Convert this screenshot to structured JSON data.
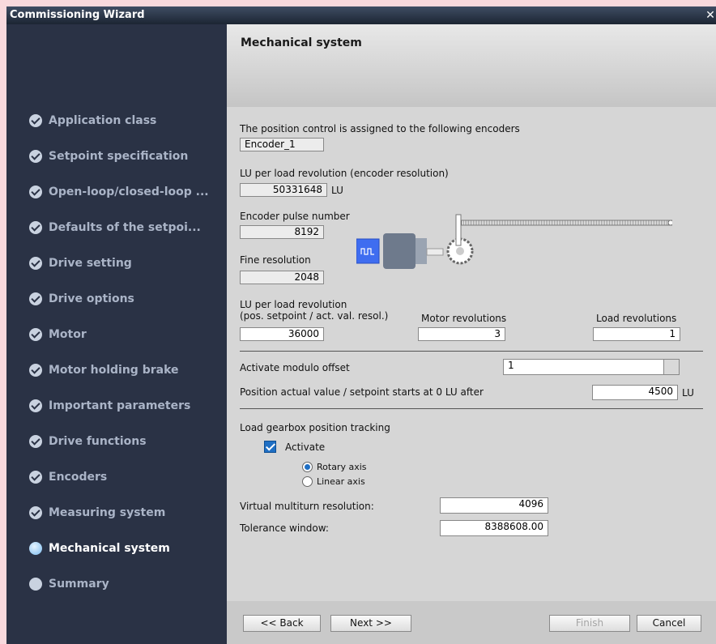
{
  "window": {
    "title": "Commissioning Wizard",
    "close_glyph": "✕"
  },
  "sidebar": {
    "items": [
      {
        "label": "Application class",
        "state": "done"
      },
      {
        "label": "Setpoint specification",
        "state": "done"
      },
      {
        "label": "Open-loop/closed-loop ...",
        "state": "done"
      },
      {
        "label": "Defaults of the setpoi...",
        "state": "done"
      },
      {
        "label": "Drive setting",
        "state": "done"
      },
      {
        "label": "Drive options",
        "state": "done"
      },
      {
        "label": "Motor",
        "state": "done"
      },
      {
        "label": "Motor holding brake",
        "state": "done"
      },
      {
        "label": "Important parameters",
        "state": "done"
      },
      {
        "label": "Drive functions",
        "state": "done"
      },
      {
        "label": "Encoders",
        "state": "done"
      },
      {
        "label": "Measuring system",
        "state": "done"
      },
      {
        "label": "Mechanical system",
        "state": "active"
      },
      {
        "label": "Summary",
        "state": "pending"
      }
    ]
  },
  "header": {
    "title": "Mechanical system"
  },
  "form": {
    "encoders_label": "The position control is assigned to the following encoders",
    "encoder_value": "Encoder_1",
    "lu_encoder_label": "LU per load revolution (encoder resolution)",
    "lu_encoder_value": "50331648",
    "lu_unit": "LU",
    "pulse_label": "Encoder pulse number",
    "pulse_value": "8192",
    "fine_label": "Fine resolution",
    "fine_value": "2048",
    "lu_pos_label_1": "LU per load revolution",
    "lu_pos_label_2": "(pos. setpoint / act. val. resol.)",
    "lu_pos_value": "36000",
    "motor_rev_label": "Motor revolutions",
    "motor_rev_value": "3",
    "load_rev_label": "Load revolutions",
    "load_rev_value": "1",
    "modulo_label": "Activate modulo offset",
    "modulo_value": "1",
    "position_label": "Position actual value / setpoint starts at 0 LU after",
    "position_value": "4500",
    "position_unit": "LU",
    "gearbox_label": "Load gearbox position tracking",
    "activate_label": "Activate",
    "activate_checked": true,
    "rotary_label": "Rotary axis",
    "linear_label": "Linear axis",
    "selected_axis": "Rotary axis",
    "multiturn_label": "Virtual multiturn resolution:",
    "multiturn_value": "4096",
    "tolerance_label": "Tolerance window:",
    "tolerance_value": "8388608.00"
  },
  "footer": {
    "back": "<< Back",
    "next": "Next >>",
    "finish": "Finish",
    "cancel": "Cancel"
  },
  "colors": {
    "sidebar_bg": "#2a3245",
    "accent_blue": "#1f6fc4",
    "motor_body": "#6e7a8c",
    "encoder_blue": "#3f6df0"
  },
  "icons": [
    "check-circle-icon",
    "active-step-icon",
    "pending-step-icon",
    "motor-illustration",
    "gear-icon",
    "close-icon"
  ]
}
